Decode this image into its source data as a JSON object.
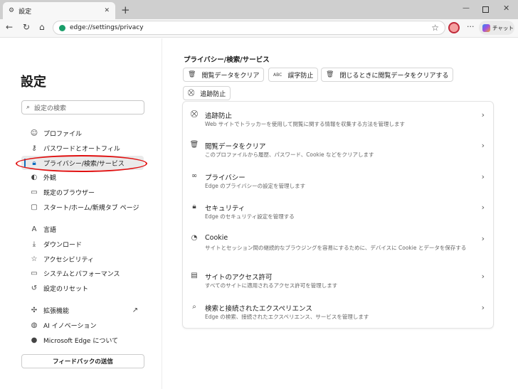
{
  "browser": {
    "tab_title": "設定",
    "url": "edge://settings/privacy",
    "chat_label": "チャット"
  },
  "sidebar": {
    "title": "設定",
    "search_placeholder": "設定の検索",
    "items": [
      {
        "label": "プロファイル",
        "icon": "profile-icon"
      },
      {
        "label": "パスワードとオートフィル",
        "icon": "key-icon"
      },
      {
        "label": "プライバシー/検索/サービス",
        "icon": "lock-icon",
        "active": true
      },
      {
        "label": "外観",
        "icon": "palette-icon"
      },
      {
        "label": "既定のブラウザー",
        "icon": "browser-icon"
      },
      {
        "label": "スタート/ホーム/新規タブ ページ",
        "icon": "home-page-icon"
      },
      {
        "label": "言語",
        "icon": "language-icon"
      },
      {
        "label": "ダウンロード",
        "icon": "download-icon"
      },
      {
        "label": "アクセシビリティ",
        "icon": "accessibility-icon"
      },
      {
        "label": "システムとパフォーマンス",
        "icon": "laptop-icon"
      },
      {
        "label": "設定のリセット",
        "icon": "reset-icon"
      },
      {
        "label": "拡張機能",
        "icon": "extensions-icon"
      },
      {
        "label": "AI イノベーション",
        "icon": "ai-icon"
      },
      {
        "label": "Microsoft Edge について",
        "icon": "edge-icon"
      }
    ],
    "feedback_label": "フィードバックの送信"
  },
  "main": {
    "section_title": "プライバシー/検索/サービス",
    "quick_buttons": [
      "閲覧データをクリア",
      "誤字防止",
      "閉じるときに閲覧データをクリアする",
      "追跡防止"
    ],
    "items": [
      {
        "title": "追跡防止",
        "desc": "Web サイトでトラッカーを使用して閲覧に関する情報を収集する方法を管理します"
      },
      {
        "title": "閲覧データをクリア",
        "desc": "このプロファイルから履歴、パスワード、Cookie などをクリアします"
      },
      {
        "title": "プライバシー",
        "desc": "Edge のプライバシーの設定を管理します"
      },
      {
        "title": "セキュリティ",
        "desc": "Edge のセキュリティ設定を管理する"
      },
      {
        "title": "Cookie",
        "desc": "サイトとセッション間の継続的なブラウジングを容易にするために、デバイスに Cookie とデータを保存する"
      },
      {
        "title": "サイトのアクセス許可",
        "desc": "すべてのサイトに適用されるアクセス許可を管理します"
      },
      {
        "title": "検索と接続されたエクスペリエンス",
        "desc": "Edge の検索、接続されたエクスペリエンス、サービスを管理します"
      }
    ]
  },
  "colors": {
    "accent": "#0f6cbd",
    "highlight_oval": "#e01010"
  }
}
